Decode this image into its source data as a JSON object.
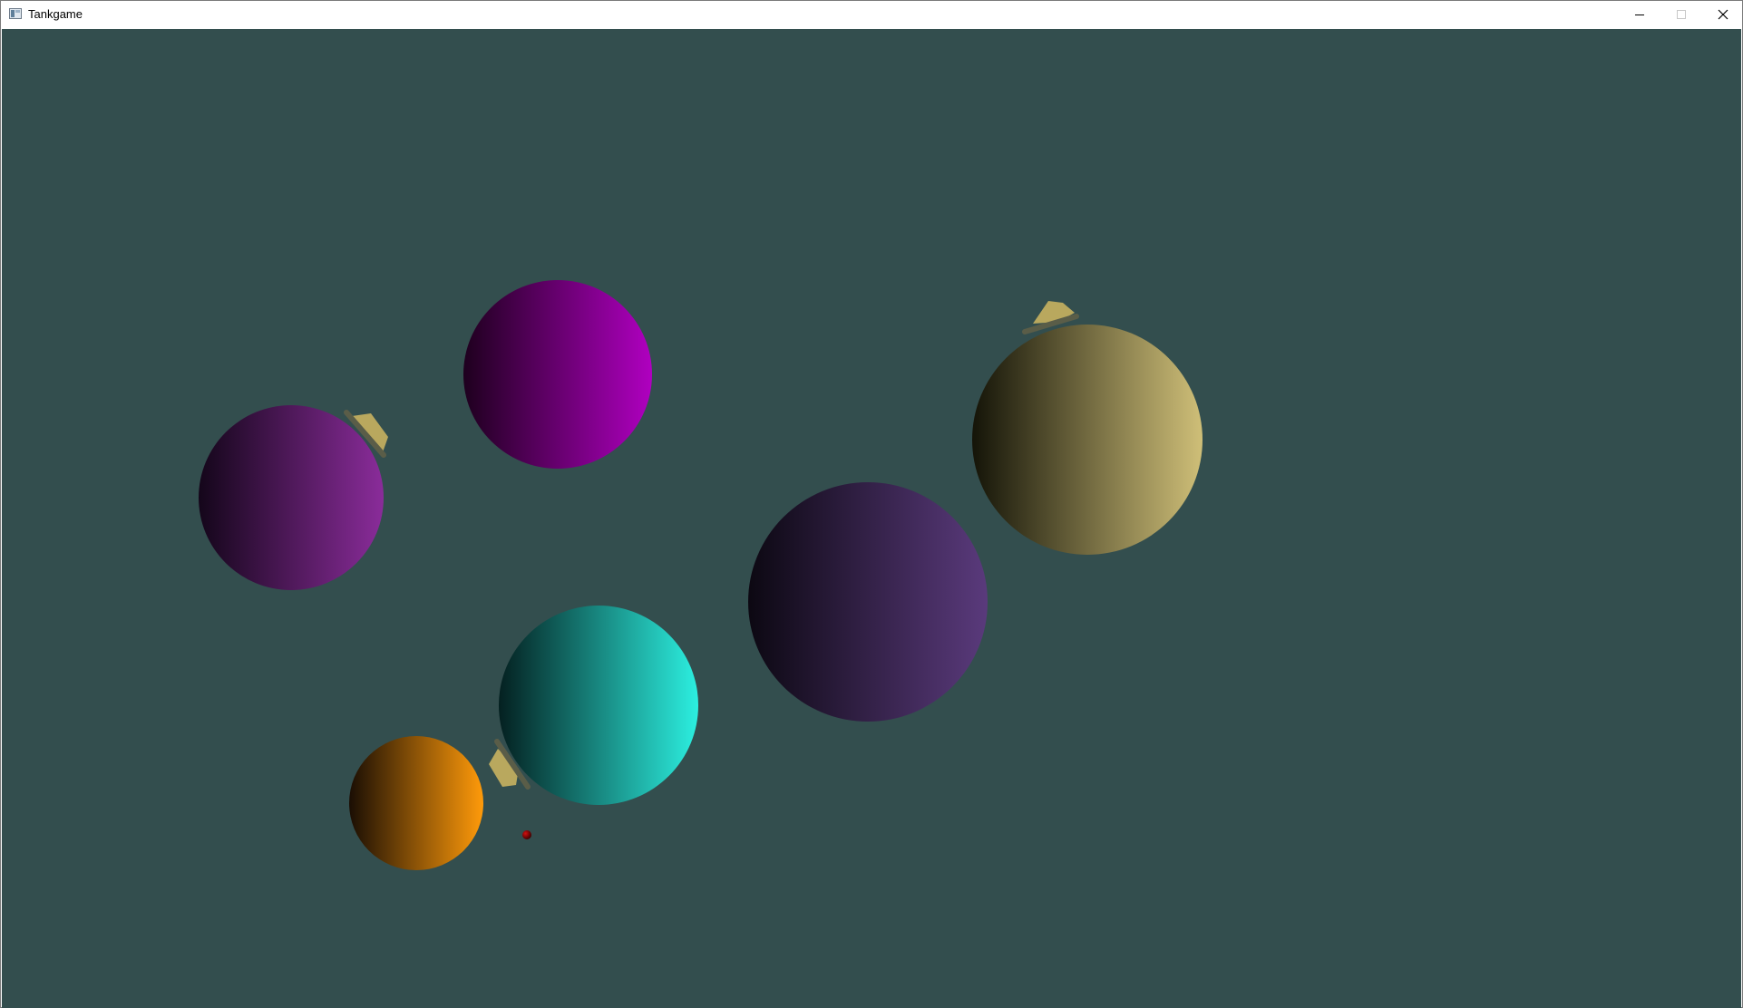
{
  "window": {
    "title": "Tankgame",
    "controls": {
      "minimize": "minimize-icon",
      "maximize": "maximize-icon",
      "close": "close-icon"
    }
  },
  "game": {
    "background_color": "#334e4e",
    "planets": [
      {
        "id": "purple-planet",
        "dark": "#14061a",
        "light": "#8a2c9a"
      },
      {
        "id": "magenta-planet",
        "dark": "#1e001e",
        "light": "#b000c0"
      },
      {
        "id": "violet-planet",
        "dark": "#0c0812",
        "light": "#5a3a7c"
      },
      {
        "id": "olive-planet",
        "dark": "#141408",
        "light": "#cfbf78"
      },
      {
        "id": "cyan-planet",
        "dark": "#042020",
        "light": "#2cefe0"
      },
      {
        "id": "orange-planet",
        "dark": "#1a0e04",
        "light": "#ff9a0a"
      }
    ],
    "tank_color": "#b9a85e",
    "barrel_color": "#5a5d48",
    "projectile_color": "#8b0000",
    "tanks": [
      "tank-on-purple-planet",
      "tank-on-olive-planet",
      "tank-on-cyan-planet"
    ],
    "status_text": ""
  }
}
